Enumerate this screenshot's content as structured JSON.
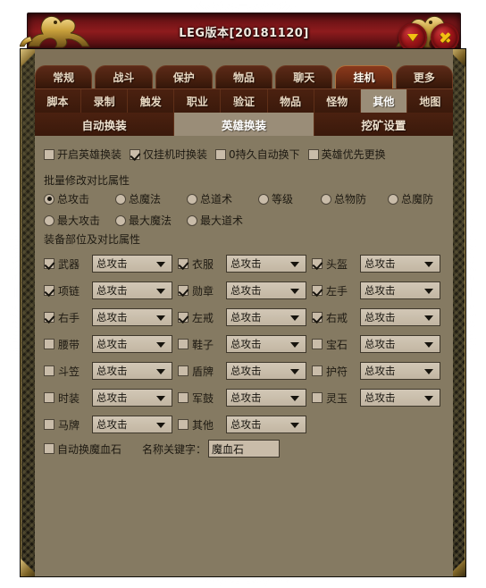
{
  "window": {
    "title": "LEG版本[20181120]",
    "minimize_icon": "triangle-down-icon",
    "close_icon": "close-x-icon",
    "accent_red": "#8e1b1d",
    "accent_gold": "#f3c012",
    "panel_bg": "#857a62",
    "tab_active_bg": "#9a8d78"
  },
  "tabs_primary": [
    {
      "label": "常规",
      "active": false
    },
    {
      "label": "战斗",
      "active": false
    },
    {
      "label": "保护",
      "active": false
    },
    {
      "label": "物品",
      "active": false
    },
    {
      "label": "聊天",
      "active": false
    },
    {
      "label": "挂机",
      "active": true
    },
    {
      "label": "更多",
      "active": false
    }
  ],
  "tabs_secondary": [
    {
      "label": "脚本",
      "active": false
    },
    {
      "label": "录制",
      "active": false
    },
    {
      "label": "触发",
      "active": false
    },
    {
      "label": "职业",
      "active": false
    },
    {
      "label": "验证",
      "active": false
    },
    {
      "label": "物品",
      "active": false
    },
    {
      "label": "怪物",
      "active": false
    },
    {
      "label": "其他",
      "active": true
    },
    {
      "label": "地图",
      "active": false
    }
  ],
  "tabs_tertiary": [
    {
      "label": "自动换装",
      "active": false
    },
    {
      "label": "英雄换装",
      "active": true
    },
    {
      "label": "挖矿设置",
      "active": false
    }
  ],
  "options": [
    {
      "label": "开启英雄换装",
      "checked": false
    },
    {
      "label": "仅挂机时换装",
      "checked": true
    },
    {
      "label": "0持久自动换下",
      "checked": false
    },
    {
      "label": "英雄优先更换",
      "checked": false
    }
  ],
  "batch_section": {
    "title": "批量修改对比属性",
    "radios_row1": [
      {
        "label": "总攻击",
        "selected": true
      },
      {
        "label": "总魔法",
        "selected": false
      },
      {
        "label": "总道术",
        "selected": false
      },
      {
        "label": "等级",
        "selected": false
      },
      {
        "label": "总物防",
        "selected": false
      },
      {
        "label": "总魔防",
        "selected": false
      }
    ],
    "radios_row2": [
      {
        "label": "最大攻击",
        "selected": false
      },
      {
        "label": "最大魔法",
        "selected": false
      },
      {
        "label": "最大道术",
        "selected": false
      }
    ]
  },
  "equip_section": {
    "title": "装备部位及对比属性",
    "rows": [
      [
        {
          "label": "武器",
          "checked": true,
          "value": "总攻击"
        },
        {
          "label": "衣服",
          "checked": true,
          "value": "总攻击"
        },
        {
          "label": "头盔",
          "checked": true,
          "value": "总攻击"
        }
      ],
      [
        {
          "label": "项链",
          "checked": true,
          "value": "总攻击"
        },
        {
          "label": "勋章",
          "checked": true,
          "value": "总攻击"
        },
        {
          "label": "左手",
          "checked": true,
          "value": "总攻击"
        }
      ],
      [
        {
          "label": "右手",
          "checked": true,
          "value": "总攻击"
        },
        {
          "label": "左戒",
          "checked": true,
          "value": "总攻击"
        },
        {
          "label": "右戒",
          "checked": true,
          "value": "总攻击"
        }
      ],
      [
        {
          "label": "腰带",
          "checked": false,
          "value": "总攻击"
        },
        {
          "label": "鞋子",
          "checked": false,
          "value": "总攻击"
        },
        {
          "label": "宝石",
          "checked": false,
          "value": "总攻击"
        }
      ],
      [
        {
          "label": "斗笠",
          "checked": false,
          "value": "总攻击"
        },
        {
          "label": "盾牌",
          "checked": false,
          "value": "总攻击"
        },
        {
          "label": "护符",
          "checked": false,
          "value": "总攻击"
        }
      ],
      [
        {
          "label": "时装",
          "checked": false,
          "value": "总攻击"
        },
        {
          "label": "军鼓",
          "checked": false,
          "value": "总攻击"
        },
        {
          "label": "灵玉",
          "checked": false,
          "value": "总攻击"
        }
      ],
      [
        {
          "label": "马牌",
          "checked": false,
          "value": "总攻击"
        },
        {
          "label": "其他",
          "checked": false,
          "value": "总攻击"
        }
      ]
    ]
  },
  "bottom": {
    "auto_swap_label": "自动换魔血石",
    "auto_swap_checked": false,
    "keyword_label": "名称关键字：",
    "keyword_value": "魔血石"
  }
}
